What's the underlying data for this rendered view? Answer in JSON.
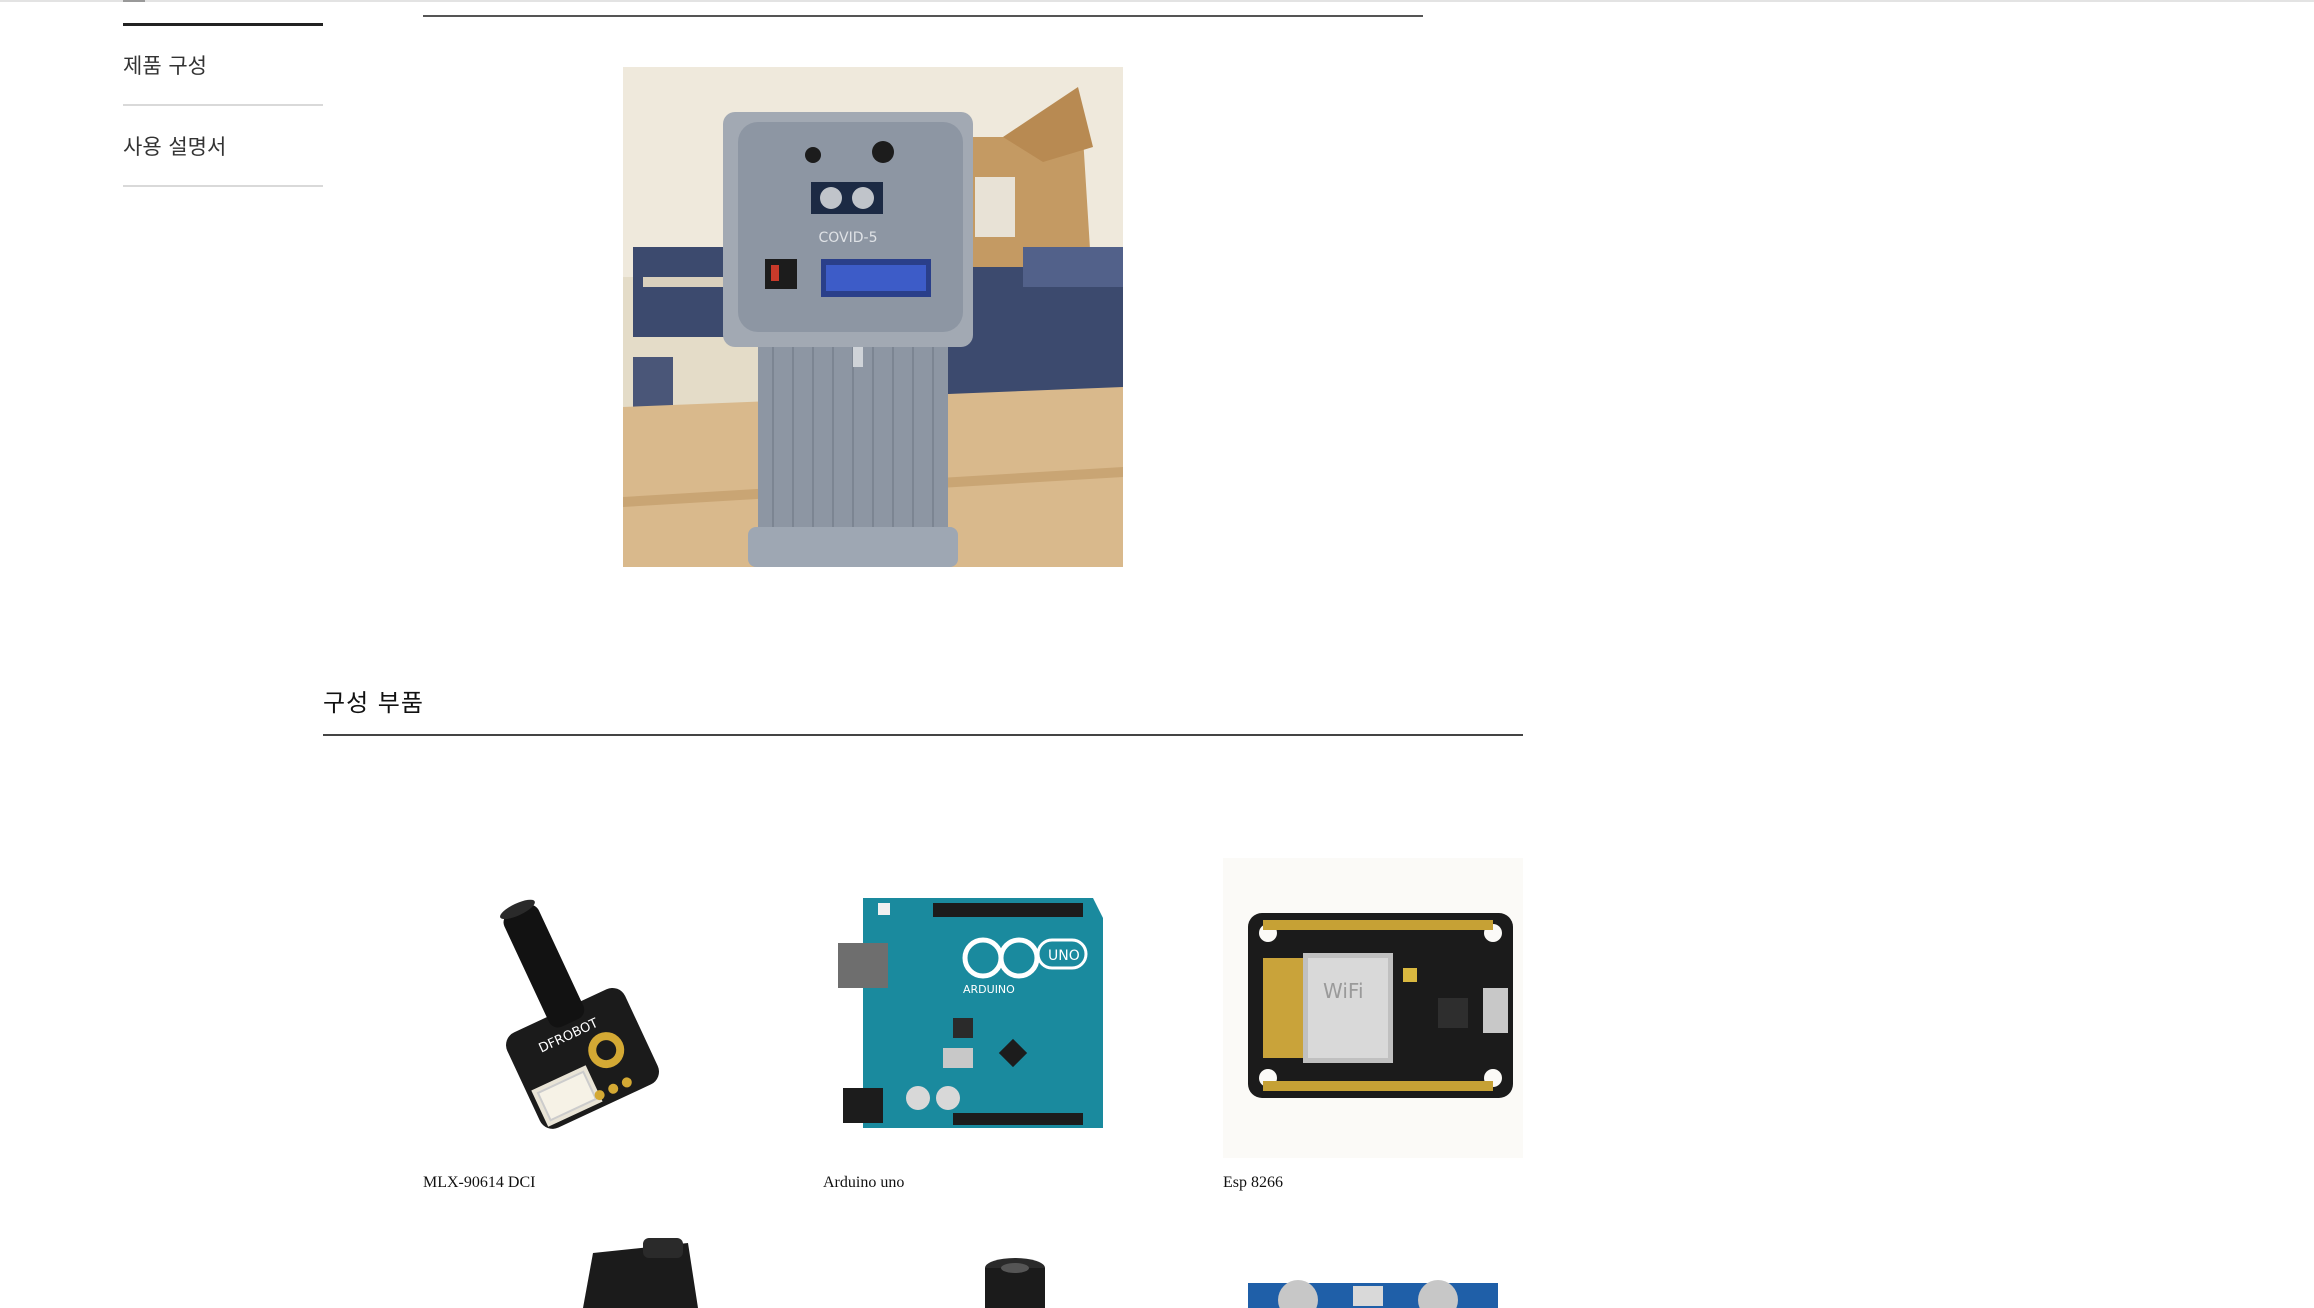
{
  "sidebar": {
    "items": [
      {
        "label": "제품 구성"
      },
      {
        "label": "사용 설명서"
      }
    ]
  },
  "hero": {
    "device_label": "COVID-5"
  },
  "section": {
    "title": "구성 부품"
  },
  "parts": [
    {
      "caption": "MLX-90614 DCI",
      "icon": "infrared-temperature-sensor"
    },
    {
      "caption": "Arduino uno",
      "icon": "arduino-uno-board"
    },
    {
      "caption": "Esp 8266",
      "icon": "esp8266-wifi-module"
    }
  ],
  "more_parts": [
    {
      "icon": "black-sensor-module"
    },
    {
      "icon": "round-buzzer"
    },
    {
      "icon": "ultrasonic-sensor"
    }
  ],
  "colors": {
    "arduino_teal": "#1a8a9e",
    "pcb_black": "#1b1b1b",
    "device_gray": "#8d96a3",
    "desk": "#d9b98c",
    "chair_blue": "#3c4a6e"
  }
}
